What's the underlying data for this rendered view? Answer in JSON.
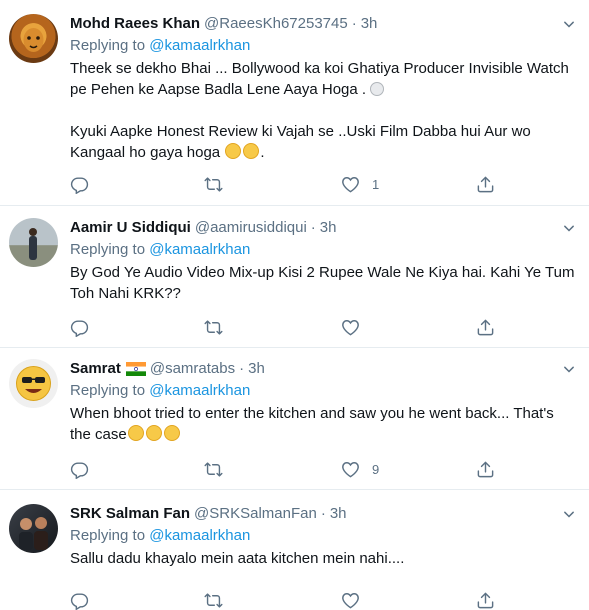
{
  "tweets": [
    {
      "name": "Mohd Raees Khan",
      "handle": "@RaeesKh67253745",
      "sep": "·",
      "time": "3h",
      "replying_prefix": "Replying to ",
      "replying_to": "@kamaalrkhan",
      "text_line1": "Theek se dekho Bhai ... Bollywood ka koi Ghatiya Producer Invisible Watch",
      "text_line2": "pe Pehen ke Aapse Badla Lene Aaya Hoga .",
      "text_line3": "Kyuki Aapke Honest Review ki Vajah se ..Uski Film Dabba hui Aur wo",
      "text_line4": "Kangaal ho gaya hoga",
      "like_count": "1"
    },
    {
      "name": "Aamir U Siddiqui",
      "handle": "@aamirusiddiqui",
      "sep": "·",
      "time": "3h",
      "replying_prefix": "Replying to ",
      "replying_to": "@kamaalrkhan",
      "text_line1": "By God Ye Audio Video Mix-up Kisi 2 Rupee Wale Ne Kiya hai. Kahi Ye Tum",
      "text_line2": "Toh Nahi KRK??"
    },
    {
      "name": "Samrat",
      "handle": "@samratabs",
      "sep": "·",
      "time": "3h",
      "replying_prefix": "Replying to ",
      "replying_to": "@kamaalrkhan",
      "text_line1": "When bhoot tried to enter the kitchen and saw you he went back... That's",
      "text_line2": "the case",
      "like_count": "9"
    },
    {
      "name": "SRK Salman Fan",
      "handle": "@SRKSalmanFan",
      "sep": "·",
      "time": "3h",
      "replying_prefix": "Replying to ",
      "replying_to": "@kamaalrkhan",
      "text_line1": "Sallu dadu khayalo mein aata kitchen mein nahi...."
    }
  ],
  "colors": {
    "text": "#0f1419",
    "secondary": "#5b7083",
    "link": "#1b95e0",
    "border": "#e6ecf0"
  },
  "icons": [
    "reply-icon",
    "retweet-icon",
    "like-icon",
    "share-icon",
    "more-icon",
    "india-flag-icon",
    "emoji-icon"
  ]
}
